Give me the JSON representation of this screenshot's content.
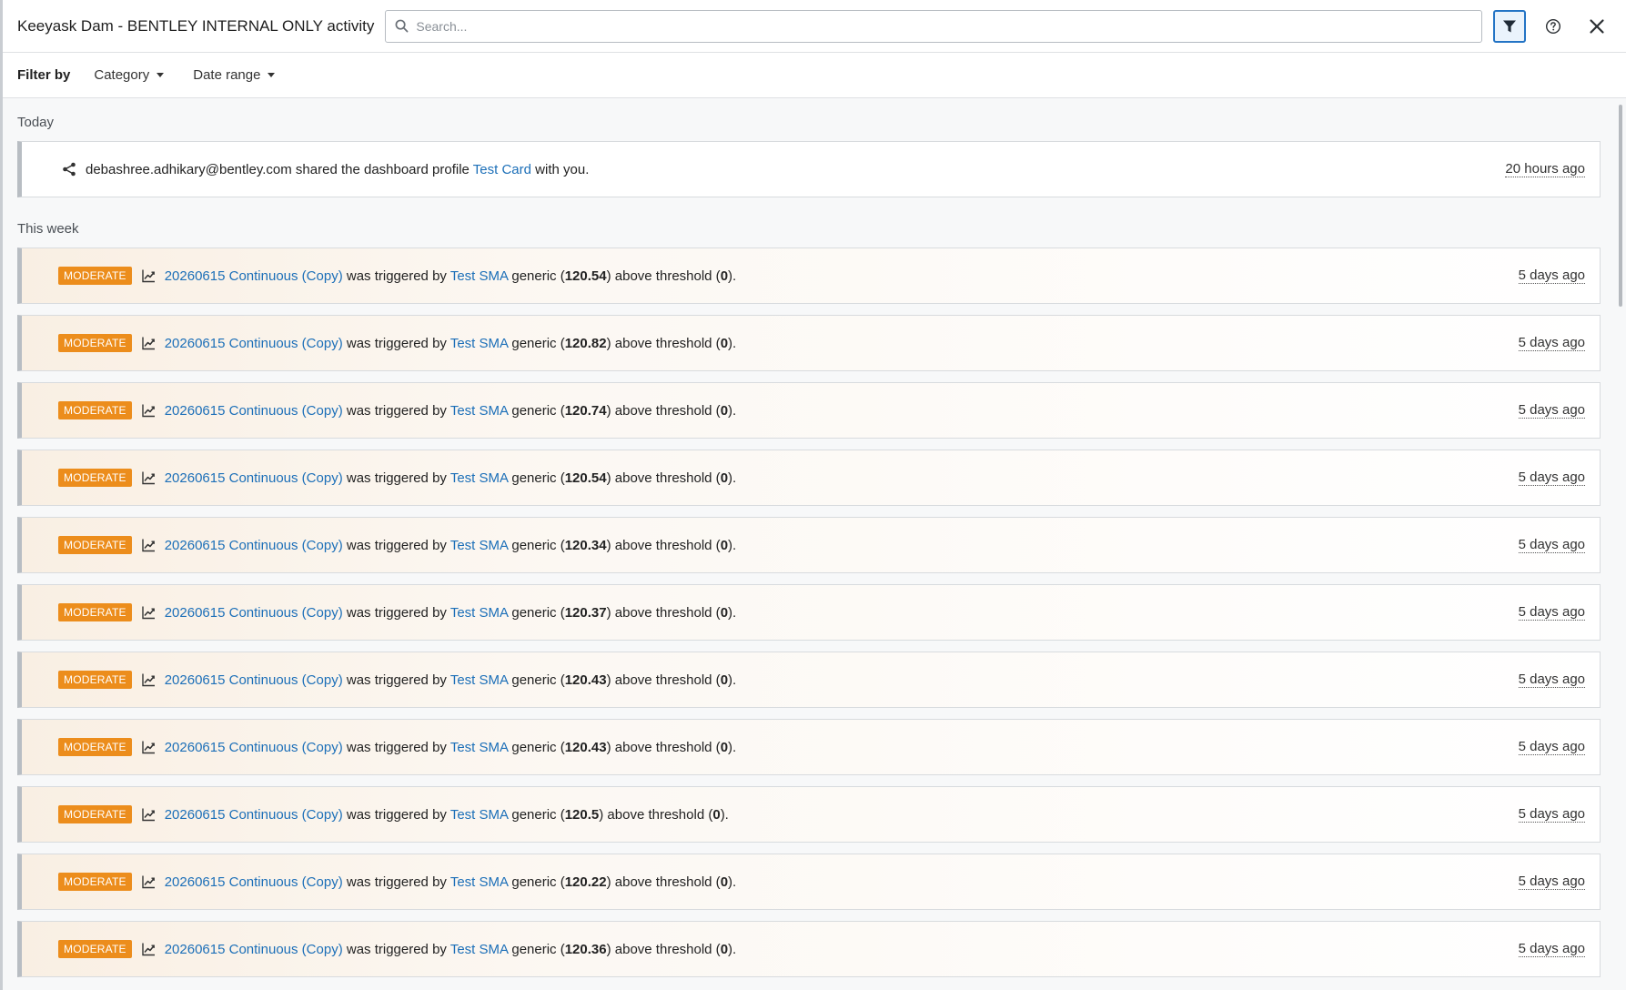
{
  "header": {
    "title": "Keeyask Dam - BENTLEY INTERNAL ONLY activity",
    "search_placeholder": "Search..."
  },
  "filters": {
    "label": "Filter by",
    "category": "Category",
    "date_range": "Date range"
  },
  "sections": {
    "today": "Today",
    "this_week": "This week"
  },
  "share_item": {
    "user": "debashree.adhikary@bentley.com",
    "text_before": "shared the dashboard profile",
    "link": "Test Card",
    "text_after": "with you.",
    "time": "20 hours ago"
  },
  "alerts": {
    "badge": "MODERATE",
    "source": "20260615 Continuous (Copy)",
    "text_triggered": "was triggered by",
    "sensor": "Test SMA",
    "text_generic": "generic (",
    "text_above": ") above threshold (",
    "threshold": "0",
    "text_end": ").",
    "time": "5 days ago",
    "values": [
      "120.54",
      "120.82",
      "120.74",
      "120.54",
      "120.34",
      "120.37",
      "120.43",
      "120.43",
      "120.5",
      "120.22",
      "120.36"
    ]
  },
  "colors": {
    "accent": "#1c6fb8",
    "badge": "#ec8d1c",
    "filter_active": "#2474c5"
  },
  "icons": {
    "search": "search-icon",
    "filter": "filter-icon",
    "help": "help-icon",
    "close": "close-icon",
    "share": "share-icon",
    "trend": "trend-line-icon"
  }
}
